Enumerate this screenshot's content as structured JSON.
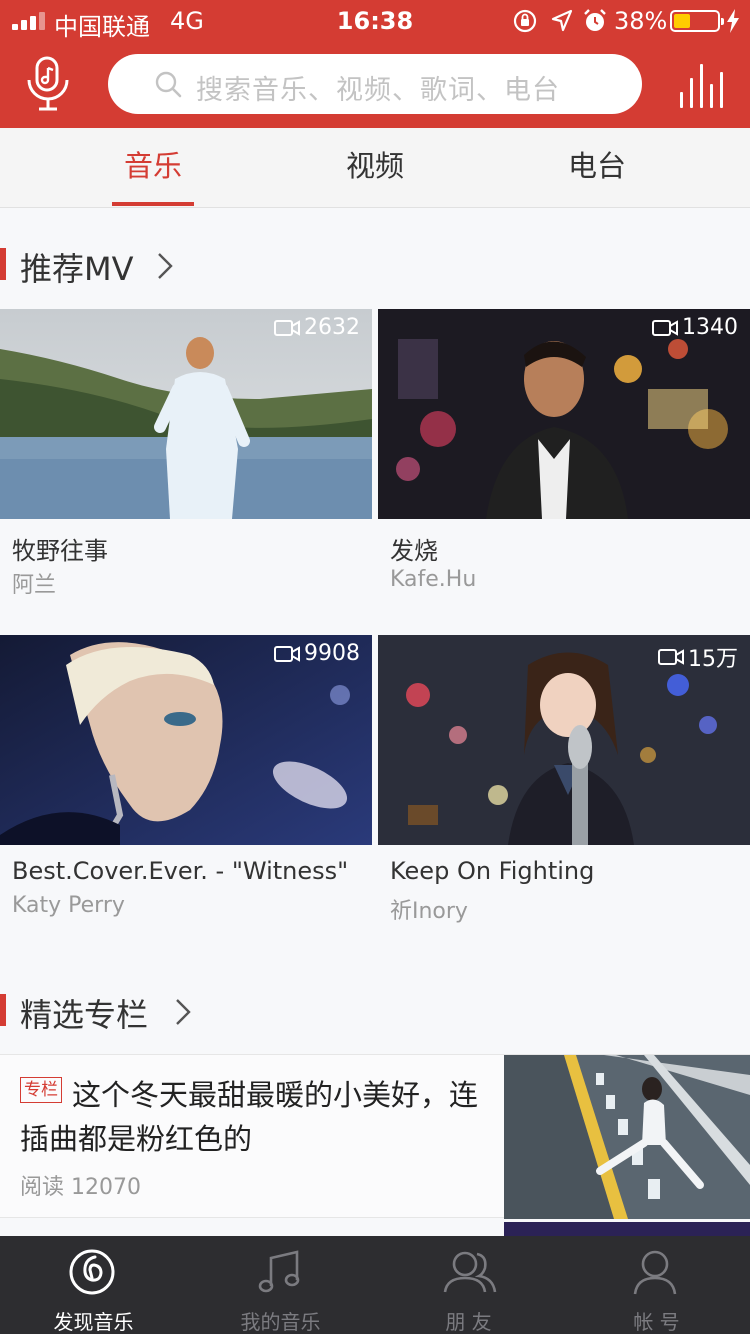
{
  "status_bar": {
    "carrier": "中国联通",
    "network": "4G",
    "time": "16:38",
    "battery": "38%",
    "battery_level": 0.38
  },
  "header": {
    "search_placeholder": "搜索音乐、视频、歌词、电台",
    "icons": [
      "voice-mic-icon",
      "search-icon",
      "equalizer-icon"
    ]
  },
  "tabs": [
    {
      "label": "音乐",
      "active": true
    },
    {
      "label": "视频",
      "active": false
    },
    {
      "label": "电台",
      "active": false
    }
  ],
  "sections": {
    "mv": {
      "title": "推荐MV"
    },
    "columns": {
      "title": "精选专栏"
    }
  },
  "mvs": [
    {
      "title": "牧野往事",
      "artist": "阿兰",
      "plays": "2632"
    },
    {
      "title": "发烧",
      "artist": "Kafe.Hu",
      "plays": "1340"
    },
    {
      "title": "Best.Cover.Ever. - \"Witness\"",
      "artist": "Katy Perry",
      "plays": "9908"
    },
    {
      "title": "Keep On Fighting",
      "artist": "祈Inory",
      "plays": "15万"
    }
  ],
  "column_article": {
    "tag": "专栏",
    "title": "这个冬天最甜最暖的小美好，连插曲都是粉红色的",
    "reads": "阅读 12070"
  },
  "bottom_nav": [
    {
      "label": "发现音乐",
      "icon": "discover-music-icon",
      "active": true
    },
    {
      "label": "我的音乐",
      "icon": "music-note-icon",
      "active": false
    },
    {
      "label": "朋 友",
      "icon": "friends-icon",
      "active": false
    },
    {
      "label": "帐 号",
      "icon": "account-icon",
      "active": false
    }
  ],
  "colors": {
    "brand_red": "#d43c33",
    "nav_bg": "#2d2d30"
  }
}
